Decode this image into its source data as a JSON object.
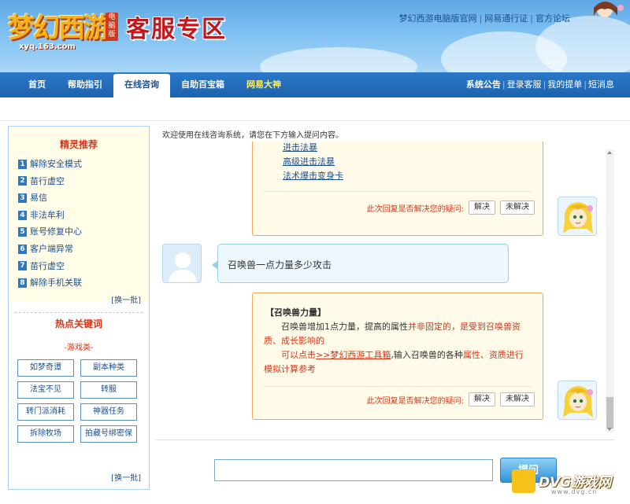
{
  "header": {
    "logo_text": "梦幻西游",
    "logo_badge": "电脑版",
    "logo_url": "xyq.163.com",
    "title": "客服专区",
    "top_links": [
      "梦幻西游电脑版官网",
      "网易通行证",
      "官方论坛"
    ]
  },
  "nav": {
    "tabs": [
      {
        "label": "首页"
      },
      {
        "label": "帮助指引"
      },
      {
        "label": "在线咨询"
      },
      {
        "label": "自助百宝箱"
      },
      {
        "label": "网易大神"
      }
    ],
    "active_tab": "在线咨询",
    "right_links": [
      "系统公告",
      "登录客服",
      "我的提单",
      "短消息"
    ]
  },
  "sidebar": {
    "rec_title": "精灵推荐",
    "rec_items": [
      {
        "num": "1",
        "label": "解除安全模式"
      },
      {
        "num": "2",
        "label": "苗行虚空"
      },
      {
        "num": "3",
        "label": "易信"
      },
      {
        "num": "4",
        "label": "非法牟利"
      },
      {
        "num": "5",
        "label": "账号修复中心"
      },
      {
        "num": "6",
        "label": "客户端异常"
      },
      {
        "num": "7",
        "label": "苗行虚空"
      },
      {
        "num": "8",
        "label": "解除手机关联"
      }
    ],
    "refresh_label": "[换一批]",
    "kw_title": "热点关键词",
    "kw_category": "-游戏类-",
    "keywords": [
      "如梦奇谭",
      "副本种类",
      "法宝不见",
      "转服",
      "转门派消耗",
      "神器任务",
      "拆除牧场",
      "拍藏号绑密保"
    ],
    "refresh_label_2": "[换一批]"
  },
  "main": {
    "welcome": "欢迎使用在线咨询系统，请您在下方输入提问内容。",
    "bot_links": [
      "进击法暴",
      "高级进击法暴",
      "法术爆击变身卡"
    ],
    "feedback_q": "此次回复是否解决您的疑问:",
    "btn_solved": "解决",
    "btn_unsolved": "未解决",
    "user_msg": "召唤兽一点力量多少攻击",
    "answer_title": "【召唤兽力量】",
    "answer_line1_a": "召唤兽增加1点力量，提高的属性",
    "answer_line1_b": "并非固定的，是受到召唤兽资质、成长影响的",
    "answer_line2_a": "可以点击",
    "answer_link": ">>梦幻西游工具箱",
    "answer_line2_b": ",输入召唤兽的各种",
    "answer_line2_c": "属性、资质进行模拟计算参考",
    "ask_button": "提问",
    "input_value": ""
  },
  "watermark": {
    "text": "DVG游戏网",
    "sub": "www.dvg.cn"
  }
}
